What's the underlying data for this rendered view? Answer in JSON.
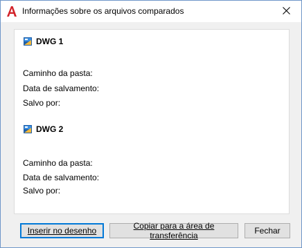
{
  "window": {
    "title": "Informações sobre os arquivos comparados",
    "close_icon": "close-icon",
    "app_icon": "autocad-a-icon"
  },
  "dwg1": {
    "heading": "DWG 1",
    "icon": "dwg-file-icon",
    "folder_path_label": "Caminho da pasta:",
    "save_date_label": "Data de salvamento:",
    "saved_by_label": "Salvo por:"
  },
  "dwg2": {
    "heading": "DWG 2",
    "icon": "dwg-file-icon",
    "folder_path_label": "Caminho da pasta:",
    "save_date_label": "Data de salvamento:",
    "saved_by_label": "Salvo por:"
  },
  "buttons": {
    "insert": "Inserir no desenho",
    "copy": "Copiar para a área de transferência",
    "close": "Fechar"
  }
}
